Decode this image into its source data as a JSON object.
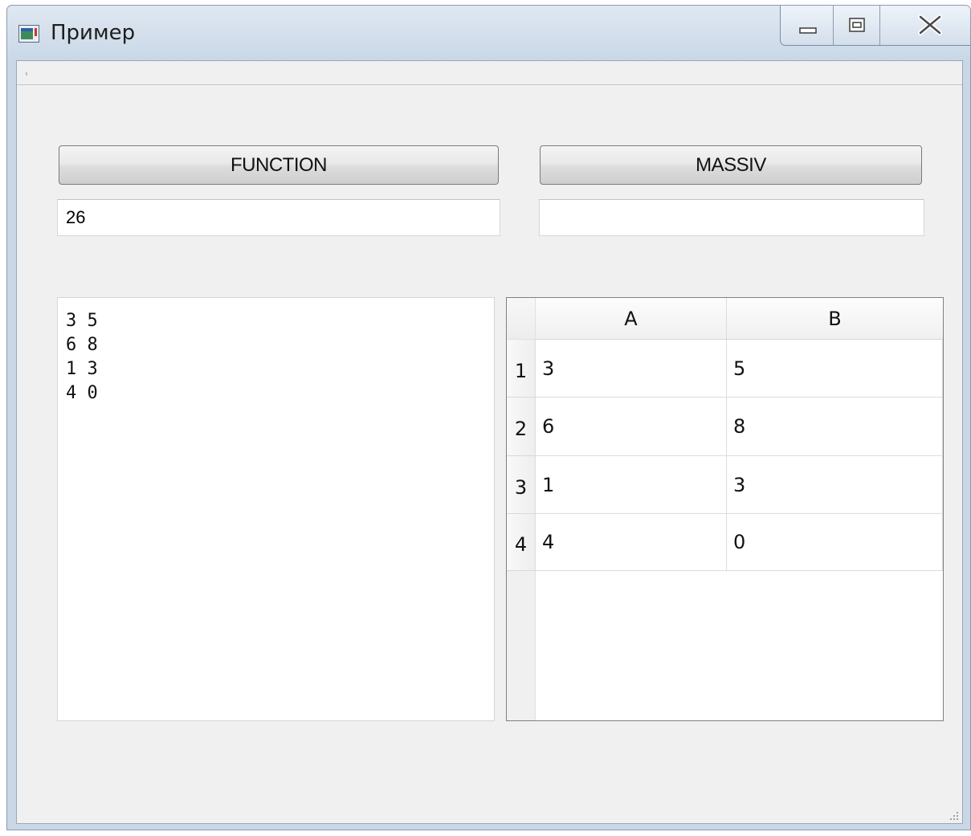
{
  "window": {
    "title": "Пример",
    "icons": {
      "app": "app-window-icon",
      "minimize": "minimize-icon",
      "maximize": "maximize-icon",
      "close": "close-icon",
      "size_grip": "resize-grip-icon"
    }
  },
  "buttons": {
    "function_label": "FUNCTION",
    "massiv_label": "MASSIV"
  },
  "fields": {
    "function_result": "26",
    "massiv_result": ""
  },
  "memo": {
    "lines": [
      "3 5",
      "6 8",
      "1 3",
      "4 0"
    ]
  },
  "table": {
    "columns": [
      "A",
      "B"
    ],
    "row_headers": [
      "1",
      "2",
      "3",
      "4"
    ],
    "rows": [
      [
        "3",
        "5"
      ],
      [
        "6",
        "8"
      ],
      [
        "1",
        "3"
      ],
      [
        "4",
        "0"
      ]
    ]
  }
}
